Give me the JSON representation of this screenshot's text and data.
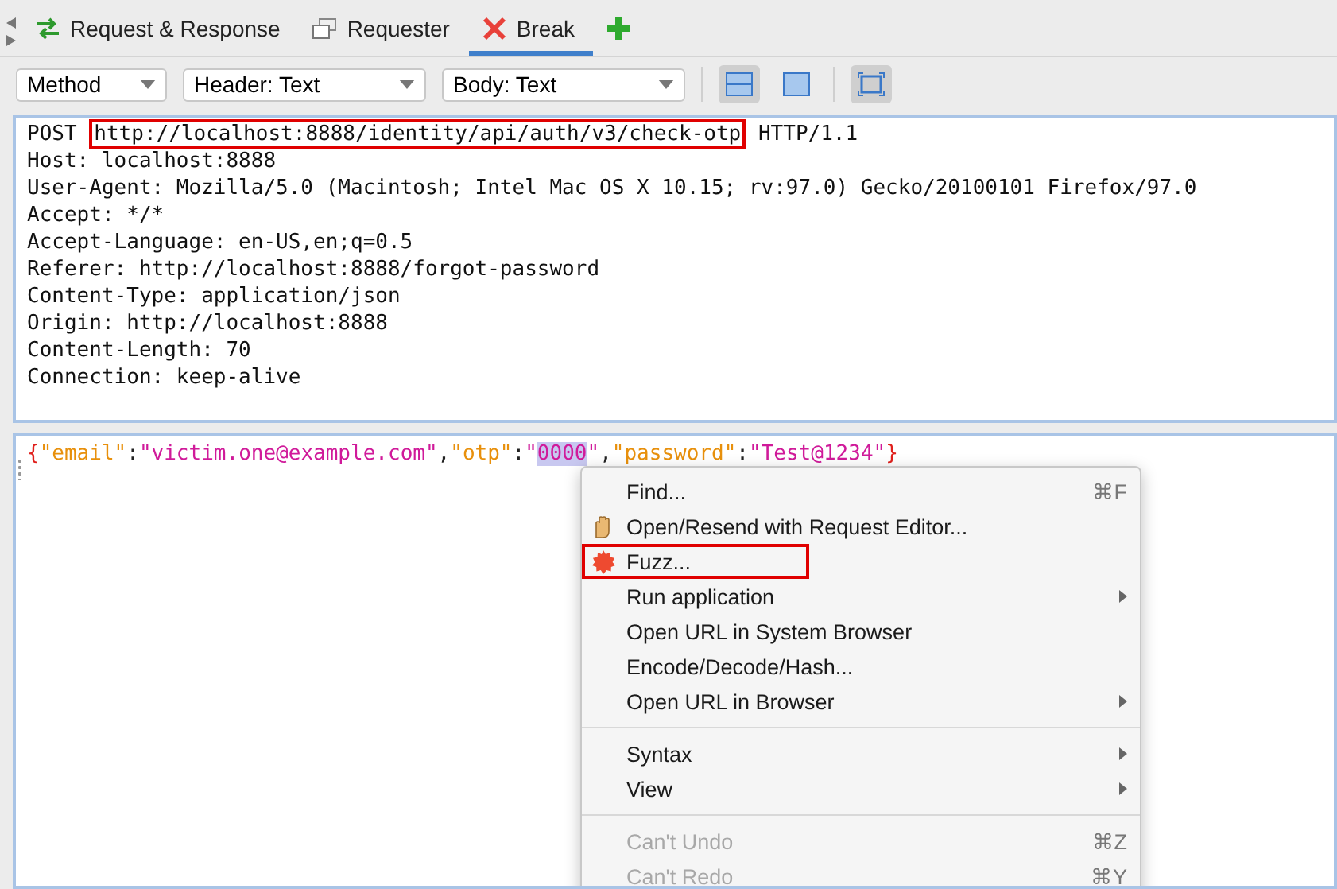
{
  "tabs": [
    {
      "label": "Request & Response",
      "selected": false
    },
    {
      "label": "Requester",
      "selected": false
    },
    {
      "label": "Break",
      "selected": true
    }
  ],
  "toolbar": {
    "selects": [
      {
        "value": "Method"
      },
      {
        "value": "Header: Text"
      },
      {
        "value": "Body: Text"
      }
    ],
    "layout_buttons": [
      {
        "kind": "split",
        "selected": true
      },
      {
        "kind": "single",
        "selected": false
      },
      {
        "kind": "expand",
        "selected": true
      }
    ]
  },
  "header": {
    "request_line": {
      "method": "POST",
      "url": "http://localhost:8888/identity/api/auth/v3/check-otp",
      "version": "HTTP/1.1",
      "highlighted": true
    },
    "lines": [
      "Host: localhost:8888",
      "User-Agent: Mozilla/5.0 (Macintosh; Intel Mac OS X 10.15; rv:97.0) Gecko/20100101 Firefox/97.0",
      "Accept: */*",
      "Accept-Language: en-US,en;q=0.5",
      "Referer: http://localhost:8888/forgot-password",
      "Content-Type: application/json",
      "Origin: http://localhost:8888",
      "Content-Length: 70",
      "Connection: keep-alive"
    ]
  },
  "body": {
    "tokens": [
      {
        "text": "{",
        "kind": "brace",
        "selected": false
      },
      {
        "text": "\"email\"",
        "kind": "key",
        "selected": false
      },
      {
        "text": ":",
        "kind": "punct",
        "selected": false
      },
      {
        "text": "\"victim.one@example.com\"",
        "kind": "string",
        "selected": false
      },
      {
        "text": ",",
        "kind": "punct",
        "selected": false
      },
      {
        "text": "\"otp\"",
        "kind": "key",
        "selected": false
      },
      {
        "text": ":",
        "kind": "punct",
        "selected": false
      },
      {
        "text": "\"",
        "kind": "string",
        "selected": false
      },
      {
        "text": "0000",
        "kind": "string",
        "selected": true
      },
      {
        "text": "\"",
        "kind": "string",
        "selected": false
      },
      {
        "text": ",",
        "kind": "punct",
        "selected": false
      },
      {
        "text": "\"password\"",
        "kind": "key",
        "selected": false
      },
      {
        "text": ":",
        "kind": "punct",
        "selected": false
      },
      {
        "text": "\"Test@1234\"",
        "kind": "string",
        "selected": false
      },
      {
        "text": "}",
        "kind": "brace",
        "selected": false
      }
    ]
  },
  "context_menu": {
    "groups": [
      [
        {
          "label": "Find...",
          "shortcut": "⌘F",
          "submenu": false,
          "disabled": false,
          "highlighted": false
        },
        {
          "label": "Open/Resend with Request Editor...",
          "submenu": false,
          "disabled": false,
          "highlighted": false
        },
        {
          "label": "Fuzz...",
          "submenu": false,
          "disabled": false,
          "highlighted": true
        },
        {
          "label": "Run application",
          "submenu": true,
          "disabled": false,
          "highlighted": false
        },
        {
          "label": "Open URL in System Browser",
          "submenu": false,
          "disabled": false,
          "highlighted": false
        },
        {
          "label": "Encode/Decode/Hash...",
          "submenu": false,
          "disabled": false,
          "highlighted": false
        },
        {
          "label": "Open URL in Browser",
          "submenu": true,
          "disabled": false,
          "highlighted": false
        }
      ],
      [
        {
          "label": "Syntax",
          "submenu": true,
          "disabled": false,
          "highlighted": false
        },
        {
          "label": "View",
          "submenu": true,
          "disabled": false,
          "highlighted": false
        }
      ],
      [
        {
          "label": "Can't Undo",
          "shortcut": "⌘Z",
          "submenu": false,
          "disabled": true,
          "highlighted": false
        },
        {
          "label": "Can't Redo",
          "shortcut": "⌘Y",
          "submenu": false,
          "disabled": true,
          "highlighted": false
        }
      ]
    ]
  }
}
